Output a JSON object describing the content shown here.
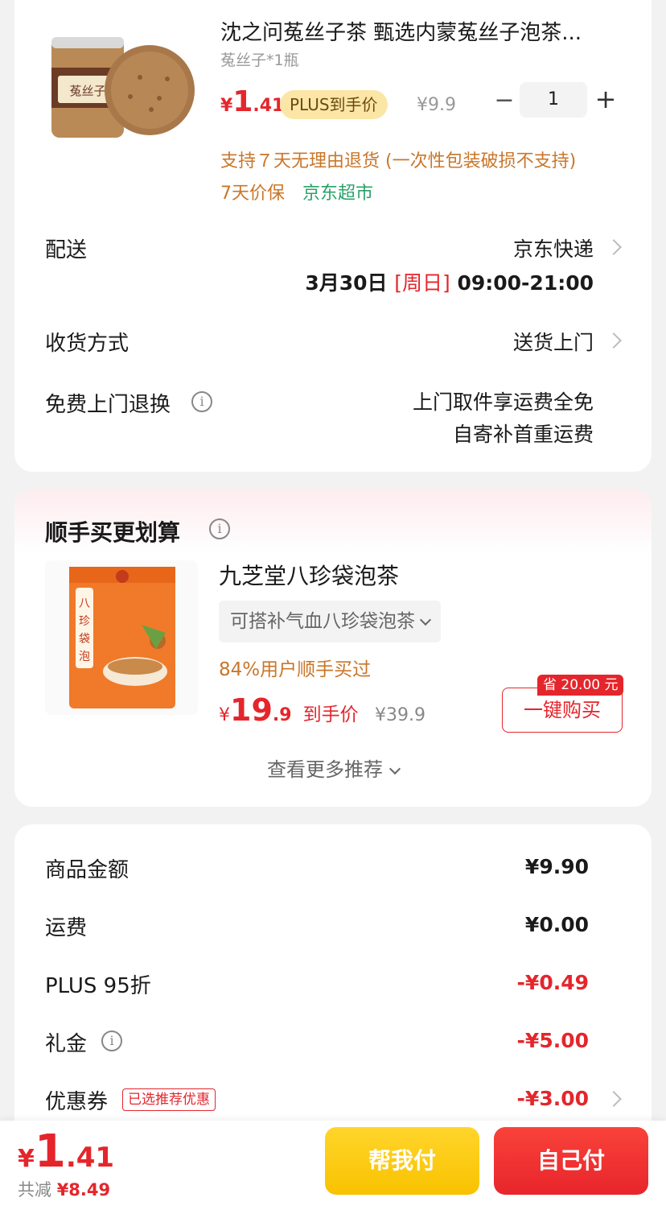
{
  "colors": {
    "accent_red": "#e4262c",
    "orange_note": "#c9762a",
    "green_jd": "#2ca36b",
    "plus_gold": "#fbe6a6"
  },
  "product1": {
    "title": "沈之问菟丝子茶 甄选内蒙菟丝子泡茶...",
    "spec": "菟丝子*1瓶",
    "price_currency": "¥",
    "price_int": "1",
    "price_dec": ".41",
    "plus_tag": "PLUS到手价",
    "original_price": "¥9.9",
    "qty_minus": "−",
    "quantity": "1",
    "qty_plus": "+",
    "return_note": "支持７天无理由退货 (一次性包装破损不支持)",
    "price_guard": "7天价保",
    "store": "京东超市",
    "image_label": "菟丝子"
  },
  "delivery": {
    "label": "配送",
    "carrier": "京东快递",
    "date": "3月30日",
    "weekday": "[周日]",
    "time": "09:00-21:00"
  },
  "receive": {
    "label": "收货方式",
    "value": "送货上门"
  },
  "free_return": {
    "label": "免费上门退换",
    "line1": "上门取件享运费全免",
    "line2": "自寄补首重运费"
  },
  "bundle": {
    "title": "顺手买更划算",
    "product_title": "九芝堂八珍袋泡茶",
    "spec": "可搭补气血八珍袋泡茶",
    "bought_text": "84%用户顺手买过",
    "price_currency": "¥",
    "price_int": "19",
    "price_dec": ".9",
    "price_after": "到手价",
    "original_price": "¥39.9",
    "save_tag": "省 20.00 元",
    "buy_button": "一键购买",
    "more": "查看更多推荐",
    "image_label": "八珍袋泡茶"
  },
  "summary": {
    "goods_label": "商品金额",
    "goods_value": "¥9.90",
    "shipping_label": "运费",
    "shipping_value": "¥0.00",
    "plus_label": "PLUS 95折",
    "plus_value": "-¥0.49",
    "gift_label": "礼金",
    "gift_value": "-¥5.00",
    "coupon_label": "优惠券",
    "coupon_tag": "已选推荐优惠",
    "coupon_value": "-¥3.00"
  },
  "bottom": {
    "total_currency": "¥",
    "total_int": "1",
    "total_dec": ".41",
    "save_prefix": "共减",
    "save_amount": "¥8.49",
    "help_pay": "帮我付",
    "self_pay": "自己付"
  },
  "icons": [
    "info-icon",
    "chevron-right-icon",
    "chevron-down-icon"
  ]
}
